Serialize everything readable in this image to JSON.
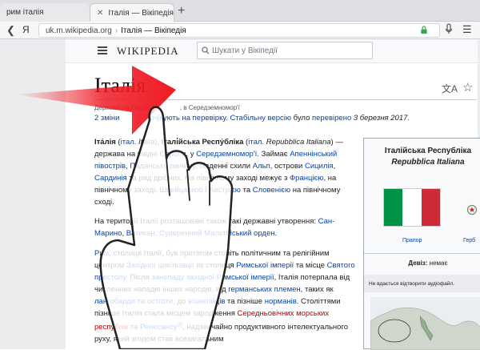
{
  "browser": {
    "tabs": [
      {
        "label": "рим італія"
      },
      {
        "label": "Італія — Вікіпедія"
      }
    ],
    "new_tab": "+",
    "yandex_button": "Я",
    "address_domain": "uk.m.wikipedia.org",
    "address_title": "Італія — Вікіпедія"
  },
  "wiki_header": {
    "logo": "WIKIPEDIA",
    "search_placeholder": "Шукати у Вікіпедії"
  },
  "article": {
    "title": "Італія",
    "description_start": "Держава на Півдні ",
    "description_end": ", в Середземномор'ї",
    "review": {
      "count_link": "2 зміни",
      "mid_link": "очікують на перевірку.",
      "stable_link": "Стабільну версію",
      "text_was": " було ",
      "checked_link": "перевірено",
      "date": " 3 березня 2017."
    },
    "p1": {
      "bold1": "Іта́лія",
      "t1": " (",
      "l1": "італ.",
      "t2": " ",
      "i1": "Italia",
      "t3": "), ",
      "bold2": "Італі́йська Респу́бліка",
      "t4": " (",
      "l2": "італ.",
      "t5": " ",
      "i2": "Repubblica Italiana",
      "t6": ") — держава на півдні ",
      "l3": "Європи",
      "t7": ", у ",
      "l4": "Середземномор'ї",
      "t8": ". Займає ",
      "l5": "Апеннінський півострів",
      "t9": ", ",
      "l6": "Паданську рівнину",
      "t10": ", південні схили ",
      "l7": "Альп",
      "t11": ", острови ",
      "l8": "Сицилія",
      "t12": ", ",
      "l9": "Сардинія",
      "t13": " та ряд дрібних. На північному заході межує з ",
      "l10": "Францією",
      "t14": ", на північному заході, ",
      "l11": "Швейцарією",
      "t15": " і ",
      "l12": "Австрією",
      "t16": " та ",
      "l13": "Словенією",
      "t17": " на північному сході."
    },
    "p2": {
      "t1": "На території Італії розташовані також такі державні утворення: ",
      "l1": "Сан-Марино",
      "t2": ", ",
      "l2": "Ватикан",
      "t3": ", ",
      "l3": "Суверенний Мальтійський орден",
      "t4": "."
    },
    "p3": {
      "l1": "Рим",
      "t1": ", столиця Італії, був протягом століть політичним та релігійним центром ",
      "l2": "Західної цивілізації",
      "t2": " як столиця ",
      "l3": "Римської імперії",
      "t3": " та місце ",
      "l4": "Святого престолу",
      "t4": ". Після ",
      "l5": "занепаду західної Римської імперії",
      "t5": ", Італія потерпала від численних нападів інших народів, від ",
      "l6": "германських племен",
      "t6": ", таких як ",
      "l7": "лангобарди",
      "t7": " та ",
      "l8": "остготи",
      "t8": ", до ",
      "l9": "візантійців",
      "t9": " та пізніше ",
      "l10": "норманів",
      "t10": ". Століттями пізніше Італія стала місцем зародження ",
      "r1": "Середньовічних морських республік",
      "t11": " та ",
      "l11": "Ренесансу",
      "sup": "[2]",
      "t12": ", надзвичайно продуктивного інтелектуального руху, який згодом став всезагальним"
    }
  },
  "infobox": {
    "title_line1": "Італійська Республіка",
    "title_line2": "Repubblica Italiana",
    "flag_caption": "Прапор",
    "emblem_caption": "Герб",
    "motto_label": "Девіз:",
    "motto_value": " немає",
    "audio_error": "Не вдається відтворити аудіофайл."
  },
  "colors": {
    "link": "#0645ad",
    "red_link": "#ba0000",
    "flag_green": "#009246",
    "flag_red": "#ce2b37",
    "arrow": "#ee1b24"
  }
}
